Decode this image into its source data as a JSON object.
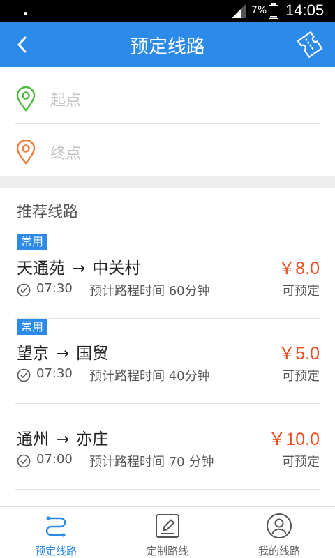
{
  "status_bar": {
    "battery": "7%",
    "time": "14:05"
  },
  "header": {
    "title": "预定线路"
  },
  "search": {
    "start_label": "起点",
    "end_label": "终点"
  },
  "recommend": {
    "title": "推荐线路",
    "routes": [
      {
        "badge": "常用",
        "from": "天通苑",
        "to": "中关村",
        "price": "￥8.0",
        "time": "07:30",
        "duration": "预计路程时间 60分钟",
        "status": "可预定"
      },
      {
        "badge": "常用",
        "from": "望京",
        "to": "国贸",
        "price": "￥5.0",
        "time": "07:30",
        "duration": "预计路程时间 40分钟",
        "status": "可预定"
      },
      {
        "badge": "",
        "from": "通州",
        "to": "亦庄",
        "price": "￥10.0",
        "time": "07:00",
        "duration": "预计路程时间 70 分钟",
        "status": "可预定"
      }
    ]
  },
  "arrow": "→",
  "nav": {
    "items": [
      {
        "label": "预定线路",
        "icon": "route-icon",
        "active": true
      },
      {
        "label": "定制路线",
        "icon": "pencil-icon",
        "active": false
      },
      {
        "label": "我的线路",
        "icon": "user-icon",
        "active": false
      }
    ]
  },
  "colors": {
    "brand": "#2c8ae8",
    "price": "#f04d1e",
    "start_pin": "#4cbb3c",
    "end_pin": "#ec7a3b"
  }
}
